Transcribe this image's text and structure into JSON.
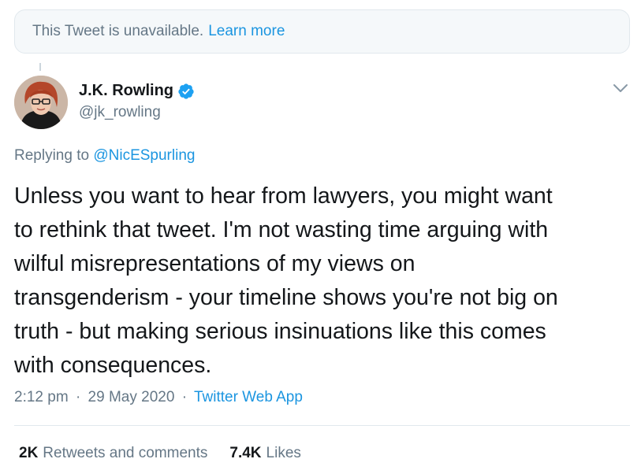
{
  "banner": {
    "message": "This Tweet is unavailable.",
    "link": "Learn more"
  },
  "author": {
    "name": "J.K. Rowling",
    "handle": "@jk_rowling",
    "verified_icon": "verified-badge-icon",
    "verified_color": "#1da1f2"
  },
  "reply": {
    "prefix": "Replying to",
    "mention": "@NicESpurling"
  },
  "tweet": {
    "lines": [
      "Unless you want to hear from lawyers, you might want",
      "to rethink that tweet. I'm not wasting time arguing with",
      "wilful misrepresentations of my views on",
      "transgenderism - your timeline shows you're not big on",
      "truth - but making serious insinuations like this comes",
      "with consequences."
    ]
  },
  "meta": {
    "time": "2:12 pm",
    "separator": "·",
    "date": "29 May 2020",
    "app": "Twitter Web App"
  },
  "stats": {
    "retweets_count": "2K",
    "retweets_label": "Retweets and comments",
    "likes_count": "7.4K",
    "likes_label": "Likes"
  },
  "colors": {
    "link": "#1b95e0",
    "muted": "#657786",
    "text": "#14171a"
  }
}
